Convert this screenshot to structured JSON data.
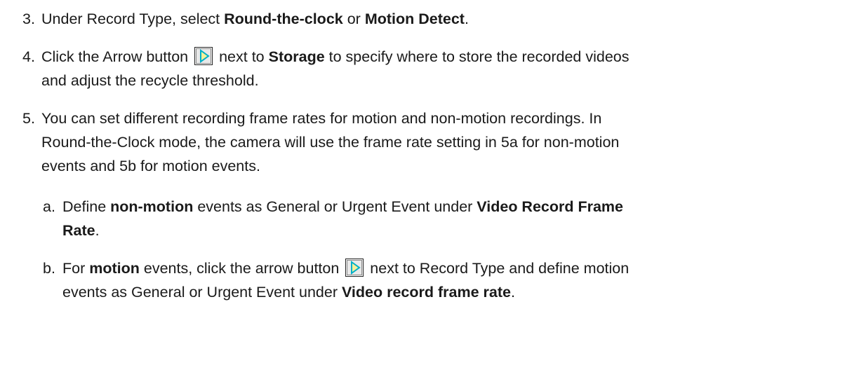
{
  "step3": {
    "num": "3.",
    "t1": "Under Record Type, select ",
    "b1": "Round-the-clock",
    "t2": " or ",
    "b2": "Motion Detect",
    "t3": "."
  },
  "step4": {
    "num": "4.",
    "t1": "Click the Arrow button",
    "t2": "next to ",
    "b1": "Storage",
    "t3": " to specify where to store the recorded videos",
    "l2": "and adjust the recycle threshold."
  },
  "step5": {
    "num": "5.",
    "l1": "You can set different recording frame rates for motion and non-motion recordings. In",
    "l2": "Round-the-Clock mode, the camera will use the frame rate setting in 5a for non-motion",
    "l3": "events and 5b for motion events."
  },
  "step5a": {
    "num": "a.",
    "t1": "Define ",
    "b1": "non-motion",
    "t2": " events as General or Urgent Event under ",
    "b2": "Video Record Frame",
    "b3": "Rate",
    "t3": "."
  },
  "step5b": {
    "num": "b.",
    "t1": "For ",
    "b1": "motion",
    "t2": " events, click the arrow button",
    "t3": "next to Record Type and define motion",
    "l2a": "events as General or Urgent Event under ",
    "b2": "Video record frame rate",
    "l2b": "."
  },
  "icons": {
    "arrow_button": "arrow-right-button-icon",
    "accent": "#00b0c8",
    "fill": "#f6f19a"
  }
}
